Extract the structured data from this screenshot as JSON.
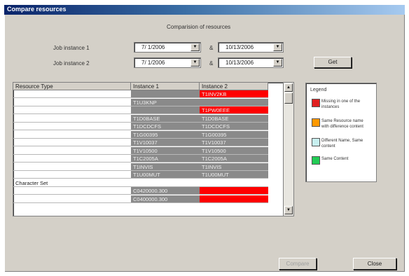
{
  "window": {
    "title": "Compare resources"
  },
  "heading": "Comparision of resources",
  "job1": {
    "label": "Job instance 1",
    "from": "7/ 1/2006",
    "and": "&",
    "to": "10/13/2006"
  },
  "job2": {
    "label": "Job instance 2",
    "from": "7/ 1/2006",
    "and": "&",
    "to": "10/13/2006"
  },
  "buttons": {
    "get": "Get",
    "compare": "Compare",
    "close": "Close"
  },
  "grid": {
    "columns": [
      "Resource Type",
      "Instance 1",
      "Instance 2"
    ],
    "rows": [
      {
        "type": "",
        "i1": "",
        "i2": "T1INV2KB",
        "c1": "#8a8a8a",
        "c2": "#ff0000"
      },
      {
        "type": "",
        "i1": "T1U3KNP",
        "i2": "",
        "c1": "#8a8a8a",
        "c2": "#8a8a8a"
      },
      {
        "type": "",
        "i1": "",
        "i2": "T1PW0EEE",
        "c1": "#8a8a8a",
        "c2": "#ff0000"
      },
      {
        "type": "",
        "i1": "T1D0BASE",
        "i2": "T1D0BASE",
        "c1": "#8a8a8a",
        "c2": "#8a8a8a"
      },
      {
        "type": "",
        "i1": "T1DCDCFS",
        "i2": "T1DCDCFS",
        "c1": "#8a8a8a",
        "c2": "#8a8a8a"
      },
      {
        "type": "",
        "i1": "T1G00395",
        "i2": "T1G00395",
        "c1": "#8a8a8a",
        "c2": "#8a8a8a"
      },
      {
        "type": "",
        "i1": "T1V10037",
        "i2": "T1V10037",
        "c1": "#8a8a8a",
        "c2": "#8a8a8a"
      },
      {
        "type": "",
        "i1": "T1V10500",
        "i2": "T1V10500",
        "c1": "#8a8a8a",
        "c2": "#8a8a8a"
      },
      {
        "type": "",
        "i1": "T1C2005A",
        "i2": "T1C2005A",
        "c1": "#8a8a8a",
        "c2": "#8a8a8a"
      },
      {
        "type": "",
        "i1": "T1INVIS",
        "i2": "T1INVIS",
        "c1": "#8a8a8a",
        "c2": "#8a8a8a"
      },
      {
        "type": "",
        "i1": "T1U00MUT",
        "i2": "T1U00MUT",
        "c1": "#8a8a8a",
        "c2": "#8a8a8a"
      },
      {
        "type": "Character Set",
        "i1": "",
        "i2": "",
        "c1": "#ffffff",
        "c2": "#ffffff"
      },
      {
        "type": "",
        "i1": "C0420000.300",
        "i2": "",
        "c1": "#8a8a8a",
        "c2": "#ff0000"
      },
      {
        "type": "",
        "i1": "C0400000.300",
        "i2": "",
        "c1": "#8a8a8a",
        "c2": "#ff0000"
      }
    ]
  },
  "legend": {
    "title": "Legend",
    "items": [
      {
        "color": "#e02020",
        "text": "Missing in one of the instances"
      },
      {
        "color": "#ff9900",
        "text": "Same Resource name with difference content"
      },
      {
        "color": "#c8f0f0",
        "text": "Different Name, Same content"
      },
      {
        "color": "#22cc55",
        "text": "Same Content"
      }
    ]
  }
}
